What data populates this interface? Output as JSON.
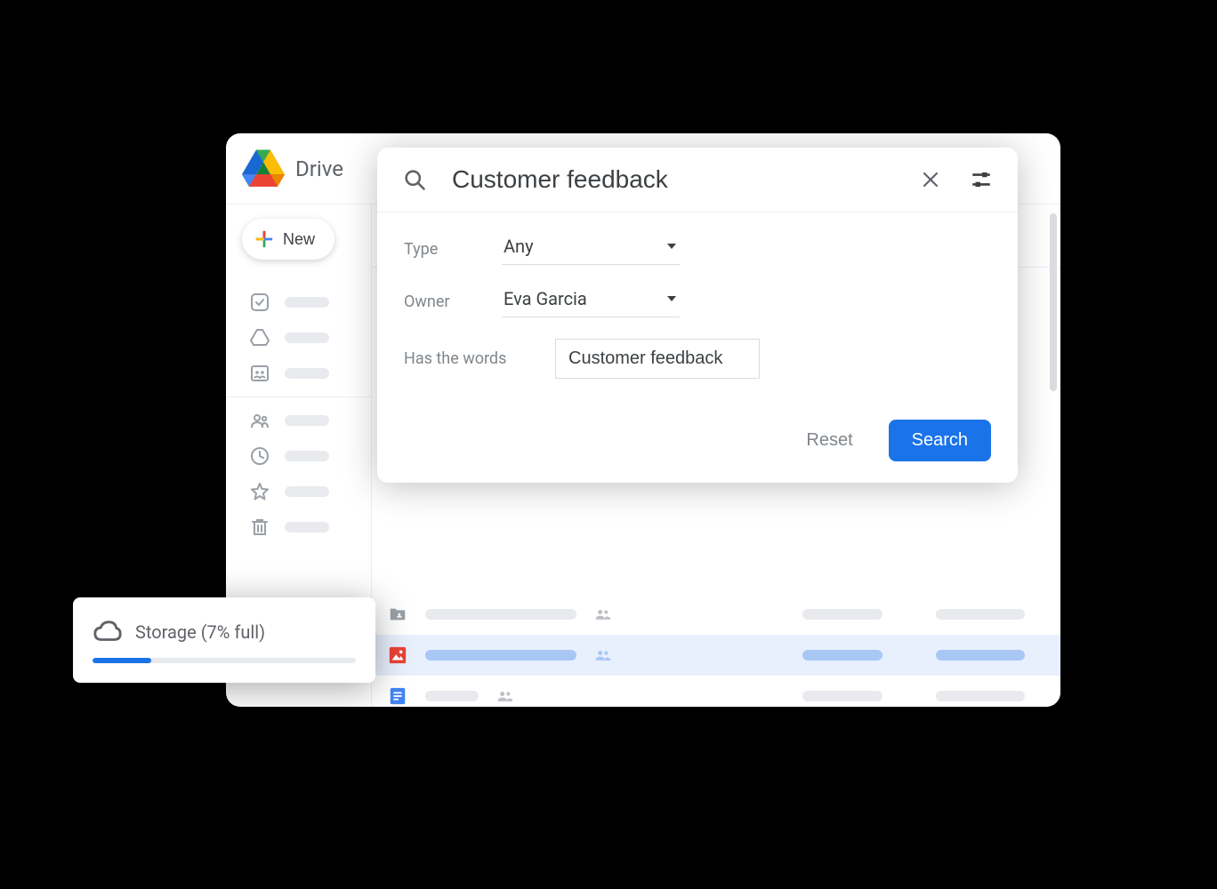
{
  "app": {
    "title": "Drive"
  },
  "new_button": {
    "label": "New"
  },
  "search": {
    "query": "Customer feedback",
    "filters": {
      "type": {
        "label": "Type",
        "value": "Any"
      },
      "owner": {
        "label": "Owner",
        "value": "Eva Garcia"
      },
      "has_words": {
        "label": "Has the words",
        "value": "Customer feedback"
      }
    },
    "reset_label": "Reset",
    "search_label": "Search"
  },
  "storage": {
    "label": "Storage (7% full)",
    "percent": 7
  }
}
